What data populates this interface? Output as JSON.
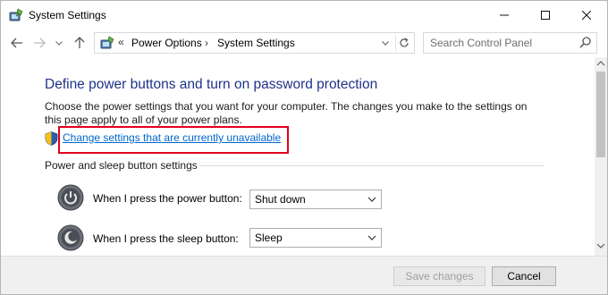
{
  "window": {
    "title": "System Settings",
    "controls": {
      "minimize": "minimize",
      "maximize": "maximize",
      "close": "close"
    }
  },
  "nav": {
    "back_icon": "arrow-left-icon",
    "forward_icon": "arrow-right-icon",
    "recent_icon": "chevron-down-icon",
    "up_icon": "arrow-up-icon"
  },
  "address": {
    "overflow": "«",
    "crumbs": [
      "Power Options",
      "System Settings"
    ],
    "separator": "›"
  },
  "search": {
    "placeholder": "Search Control Panel"
  },
  "main": {
    "title": "Define power buttons and turn on password protection",
    "description": "Choose the power settings that you want for your computer. The changes you make to the settings on this page apply to all of your power plans.",
    "change_link": "Change settings that are currently unavailable",
    "group_label": "Power and sleep button settings",
    "rows": [
      {
        "label": "When I press the power button:",
        "value": "Shut down"
      },
      {
        "label": "When I press the sleep button:",
        "value": "Sleep"
      }
    ]
  },
  "footer": {
    "save_label": "Save changes",
    "cancel_label": "Cancel"
  },
  "colors": {
    "title_blue": "#1e3287",
    "link_blue": "#0066cc",
    "highlight_red": "#e3001b"
  }
}
